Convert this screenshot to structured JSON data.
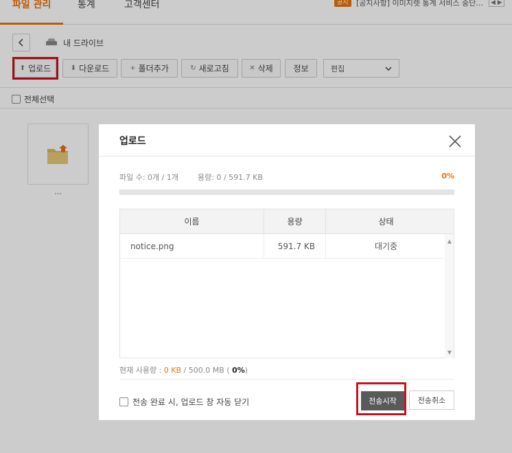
{
  "nav": {
    "tabs": [
      {
        "label": "파일 관리",
        "active": true
      },
      {
        "label": "통계",
        "active": false
      },
      {
        "label": "고객센터",
        "active": false
      }
    ],
    "notice_badge": "공지",
    "notice_text": "[공지사항] 이미지렛 통계 서비스 중단...",
    "notice_arrows": "◀ ▶"
  },
  "breadcrumb": {
    "back_icon": "chevron-left-icon",
    "drive_icon": "drive-icon",
    "label": "내 드라이브"
  },
  "toolbar": {
    "upload": "업로드",
    "download": "다운로드",
    "add_folder": "폴더추가",
    "refresh": "새로고침",
    "delete": "삭제",
    "info": "정보",
    "edit": "편집"
  },
  "select_all": "전체선택",
  "files": [
    {
      "name": "...",
      "icon": "folder-upload-icon"
    }
  ],
  "modal": {
    "title": "업로드",
    "stats_files": "파일 수: 0개 / 1개",
    "stats_capacity": "용량: 0 / 591.7 KB",
    "progress_percent": "0%",
    "progress_value": 0,
    "table": {
      "headers": [
        "이름",
        "용량",
        "상태"
      ],
      "rows": [
        {
          "name": "notice.png",
          "size": "591.7 KB",
          "status": "대기중"
        }
      ]
    },
    "usage": {
      "label": "현재 사용량 : ",
      "used": "0 KB",
      "total": " / 500.0 MB ( ",
      "percent": "0%",
      "close": ")"
    },
    "auto_close": "전송 완료 시, 업로드 창 자동 닫기",
    "start_button": "전송시작",
    "cancel_button": "전송취소"
  },
  "colors": {
    "accent": "#e8740c",
    "highlight": "#c8101e",
    "start_button": "#5a5a5a"
  }
}
